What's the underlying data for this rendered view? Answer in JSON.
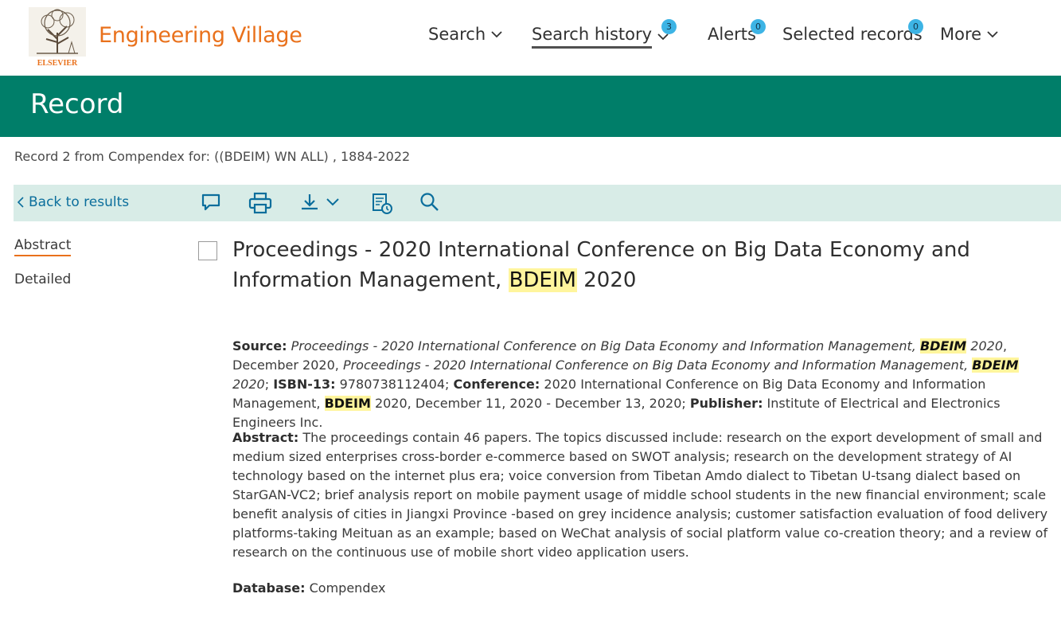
{
  "header": {
    "brand": "Engineering Village",
    "logo_text": "ELSEVIER",
    "nav": [
      {
        "label": "Search",
        "has_dropdown": true
      },
      {
        "label": "Search history",
        "has_dropdown": true,
        "badge": "3",
        "active": true
      },
      {
        "label": "Alerts",
        "badge": "0"
      },
      {
        "label": "Selected records",
        "badge": "0"
      },
      {
        "label": "More",
        "has_dropdown": true
      }
    ]
  },
  "page_title": "Record",
  "record_subtitle": "Record 2 from Compendex for: ((BDEIM) WN ALL) , 1884-2022",
  "toolbar": {
    "back_label": "Back to results",
    "icons": [
      "comment-icon",
      "print-icon",
      "download-icon",
      "history-icon",
      "search-icon"
    ]
  },
  "side_nav": [
    {
      "label": "Abstract",
      "active": true
    },
    {
      "label": "Detailed",
      "active": false
    }
  ],
  "record": {
    "title_pre": "Proceedings - 2020 International Conference on Big Data Economy and Information Management, ",
    "title_highlight": "BDEIM",
    "title_post": " 2020",
    "source": {
      "label": "Source:",
      "title1_pre": "Proceedings - 2020 International Conference on Big Data Economy and Information Management, ",
      "highlight": "BDEIM",
      "title1_post": " 2020",
      "date": ", December 2020, ",
      "title2_pre": "Proceedings - 2020 International Conference on Big Data Economy and Information Management, ",
      "title2_post": " 2020",
      "sep": "; ",
      "isbn_label": "ISBN-13:",
      "isbn": " 9780738112404",
      "conference_label": "Conference:",
      "conference_pre": " 2020 International Conference on Big Data Economy and Information Management, ",
      "conference_post": " 2020, December 11, 2020 - December 13, 2020",
      "publisher_label": "Publisher:",
      "publisher": " Institute of Electrical and Electronics Engineers Inc."
    },
    "abstract_label": "Abstract:",
    "abstract_text": " The proceedings contain 46 papers. The topics discussed include: research on the export development of small and medium sized enterprises cross-border e-commerce based on SWOT analysis; research on the development strategy of AI technology based on the internet plus era; voice conversion from Tibetan Amdo dialect to Tibetan U-tsang dialect based on StarGAN-VC2; brief analysis report on mobile payment usage of middle school students in the new financial environment; scale benefit analysis of cities in Jiangxi Province -based on grey incidence analysis; customer satisfaction evaluation of food delivery platforms-taking Meituan as an example; based on WeChat analysis of social platform value co-creation theory; and a review of research on the continuous use of mobile short video application users.",
    "database_label": "Database:",
    "database": " Compendex"
  },
  "colors": {
    "brand_orange": "#e9711c",
    "record_bar": "#007e69",
    "toolbar_bg": "#d8ece7",
    "link_blue": "#0b6e9c",
    "badge": "#3db4e5",
    "highlight": "#fff59d"
  }
}
